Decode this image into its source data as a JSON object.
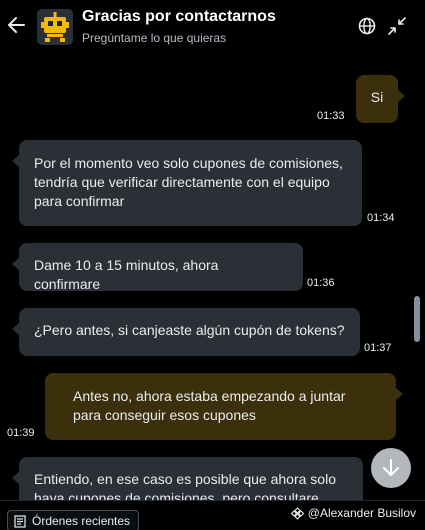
{
  "header": {
    "title": "Gracias por contactarnos",
    "subtitle": "Pregúntame lo que quieras",
    "back_icon": "arrow-left-icon",
    "avatar_icon": "robot-icon",
    "language_icon": "globe-icon",
    "collapse_icon": "collapse-arrows-icon"
  },
  "messages": [
    {
      "sender": "user",
      "text": "Si",
      "time": "01:33"
    },
    {
      "sender": "agent",
      "text": "Por el momento veo solo cupones de comisiones, tendría que verificar directamente con el equipo para confirmar",
      "time": "01:34"
    },
    {
      "sender": "agent",
      "text": "Dame 10 a 15 minutos, ahora confirmare",
      "time": "01:36"
    },
    {
      "sender": "agent",
      "text": "¿Pero antes, si canjeaste algún cupón de tokens?",
      "time": "01:37"
    },
    {
      "sender": "user",
      "text": "Antes no, ahora estaba empezando a juntar para conseguir esos cupones",
      "time": "01:39"
    },
    {
      "sender": "agent",
      "text": "Entiendo, en ese caso es posible que ahora solo haya cupones de comisiones, pero consultare",
      "time": ""
    }
  ],
  "scroll_down_icon": "arrow-down-icon",
  "footer": {
    "orders_label": "Órdenes recientes",
    "orders_icon": "receipt-icon",
    "credit_text": "@Alexander Busilov",
    "credit_icon": "binance-logo-icon"
  },
  "colors": {
    "background": "#000000",
    "agent_bubble": "#2b2f36",
    "user_bubble": "#3c2f0b",
    "accent": "#f0b90b"
  }
}
